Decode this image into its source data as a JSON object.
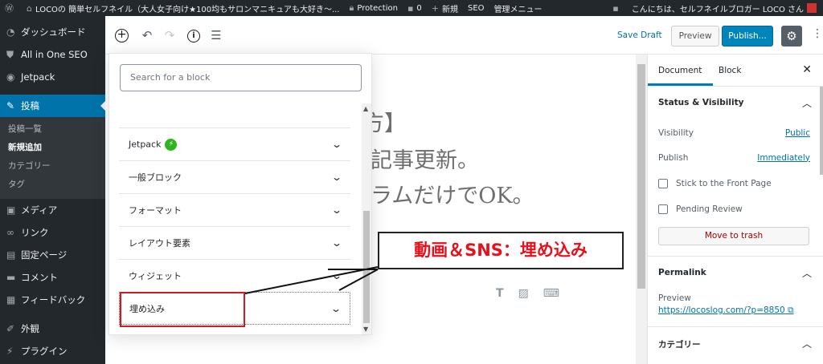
{
  "admin_bar": {
    "site_name": "LOCOの 簡単セルフネイル（大人女子向け★100均もサロンマニキュアも大好き～...",
    "protection": "Protection",
    "comments_count": "0",
    "new_label": "新規",
    "seo_label": "SEO",
    "admin_menu": "管理メニュー",
    "greeting": "こんにちは、セルフネイルブロガー LOCO さん"
  },
  "sidebar": {
    "items": [
      {
        "label": "ダッシュボード",
        "icon": "dashboard-icon"
      },
      {
        "label": "All in One SEO",
        "icon": "shield-icon"
      },
      {
        "label": "Jetpack",
        "icon": "jetpack-icon"
      },
      {
        "label": "投稿",
        "icon": "pin-icon"
      },
      {
        "label": "メディア",
        "icon": "media-icon"
      },
      {
        "label": "リンク",
        "icon": "link-icon"
      },
      {
        "label": "固定ページ",
        "icon": "page-icon"
      },
      {
        "label": "コメント",
        "icon": "comment-icon"
      },
      {
        "label": "フィードバック",
        "icon": "feedback-icon"
      },
      {
        "label": "外観",
        "icon": "appearance-icon"
      },
      {
        "label": "プラグイン",
        "icon": "plugin-icon"
      }
    ],
    "submenu": [
      "投稿一覧",
      "新規追加",
      "カテゴリー",
      "タグ"
    ]
  },
  "header": {
    "save_draft": "Save Draft",
    "preview": "Preview",
    "publish": "Publish..."
  },
  "inserter": {
    "search_placeholder": "Search for a block",
    "panels": [
      "Jetpack",
      "一般ブロック",
      "フォーマット",
      "レイアウト要素",
      "ウィジェット",
      "埋め込み"
    ]
  },
  "canvas": {
    "title_line1": "方】",
    "title_line2": "記事更新。",
    "title_line3": "ラムだけでOK。"
  },
  "settings": {
    "tab_document": "Document",
    "tab_block": "Block",
    "status_heading": "Status & Visibility",
    "visibility_label": "Visibility",
    "visibility_value": "Public",
    "publish_label": "Publish",
    "publish_value": "Immediately",
    "sticky_label": "Stick to the Front Page",
    "pending_label": "Pending Review",
    "trash_label": "Move to trash",
    "permalink_heading": "Permalink",
    "permalink_preview": "Preview",
    "permalink_url": "https://locoslog.com/?p=8850",
    "category_heading": "カテゴリー"
  },
  "annotation": {
    "callout": "動画＆SNS：埋め込み"
  },
  "colors": {
    "admin_dark": "#23282d",
    "wp_blue": "#0073aa",
    "publish_blue": "#0085ba",
    "annotation_red": "#e8101b"
  }
}
